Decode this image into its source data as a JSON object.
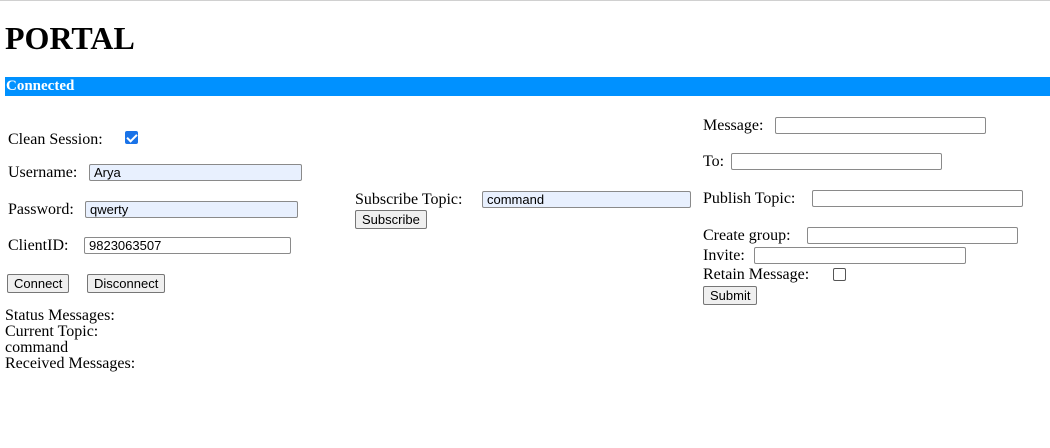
{
  "header": {
    "title": "PORTAL"
  },
  "status_bar": {
    "text": "Connected",
    "color": "#0091ff"
  },
  "connection": {
    "clean_session_label": "Clean Session:",
    "clean_session_checked": true,
    "username_label": "Username:",
    "username_value": "Arya",
    "password_label": "Password:",
    "password_value": "qwerty",
    "clientid_label": "ClientID:",
    "clientid_value": "9823063507",
    "connect_label": "Connect",
    "disconnect_label": "Disconnect"
  },
  "status": {
    "status_messages_label": "Status Messages:",
    "current_topic_label": "Current Topic:",
    "current_topic_value": "command",
    "received_messages_label": "Received Messages:"
  },
  "subscribe": {
    "topic_label": "Subscribe Topic:",
    "topic_value": "command",
    "button_label": "Subscribe"
  },
  "publish": {
    "message_label": "Message:",
    "message_value": "",
    "to_label": "To:",
    "to_value": "",
    "topic_label": "Publish Topic:",
    "topic_value": "",
    "create_group_label": "Create group:",
    "create_group_value": "",
    "invite_label": "Invite:",
    "invite_value": "",
    "retain_label": "Retain Message:",
    "retain_checked": false,
    "submit_label": "Submit"
  }
}
